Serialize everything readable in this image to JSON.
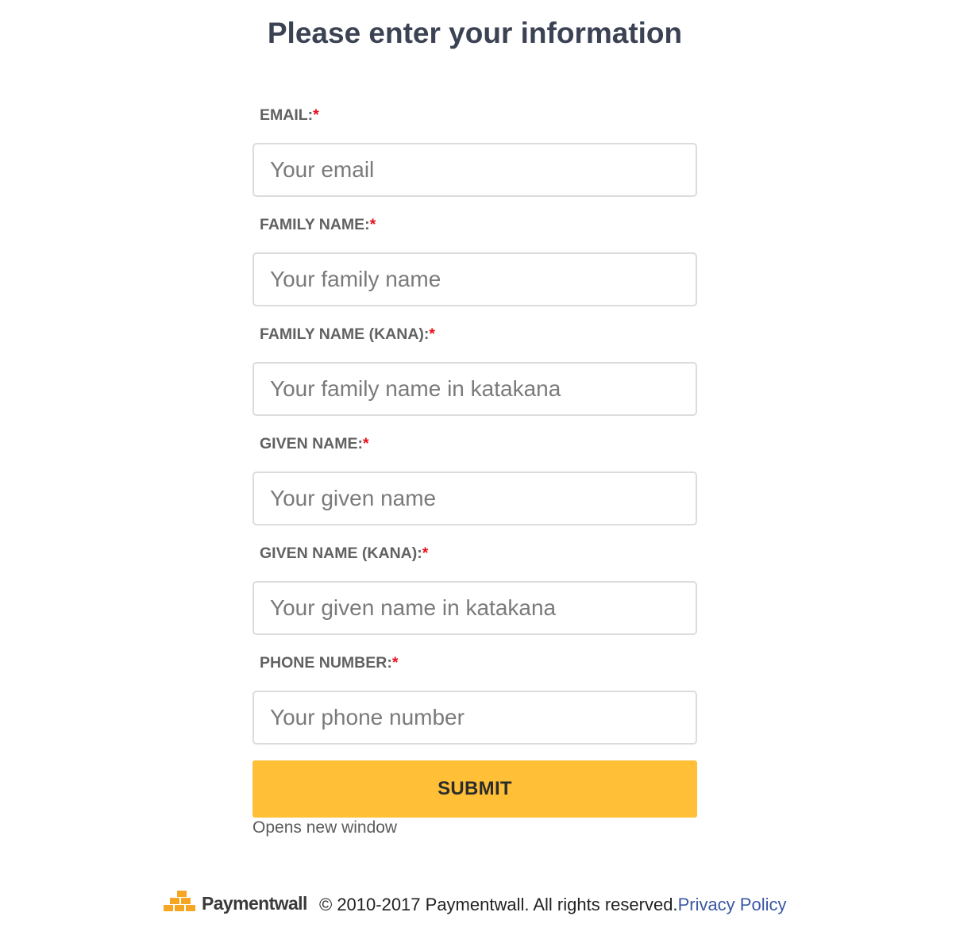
{
  "page": {
    "title": "Please enter your information"
  },
  "form": {
    "required_mark": "*",
    "fields": [
      {
        "label": "EMAIL:",
        "placeholder": "Your email",
        "value": ""
      },
      {
        "label": "FAMILY NAME:",
        "placeholder": "Your family name",
        "value": ""
      },
      {
        "label": "FAMILY NAME (KANA):",
        "placeholder": "Your family name in katakana",
        "value": ""
      },
      {
        "label": "GIVEN NAME:",
        "placeholder": "Your given name",
        "value": ""
      },
      {
        "label": "GIVEN NAME (KANA):",
        "placeholder": "Your given name in katakana",
        "value": ""
      },
      {
        "label": "PHONE NUMBER:",
        "placeholder": "Your phone number",
        "value": ""
      }
    ],
    "submit_label": "SUBMIT",
    "submit_hint": "Opens new window"
  },
  "footer": {
    "logo_text": "Paymentwall",
    "copyright": "© 2010-2017 Paymentwall. All rights reserved.",
    "privacy_link": "Privacy Policy"
  },
  "colors": {
    "title": "#3a4253",
    "label": "#616161",
    "required": "#e8101a",
    "submit_bg": "#ffc037",
    "link": "#3a58a5",
    "logo_mark": "#f5a623"
  },
  "icons": {
    "logo": "paymentwall-logo-icon"
  }
}
